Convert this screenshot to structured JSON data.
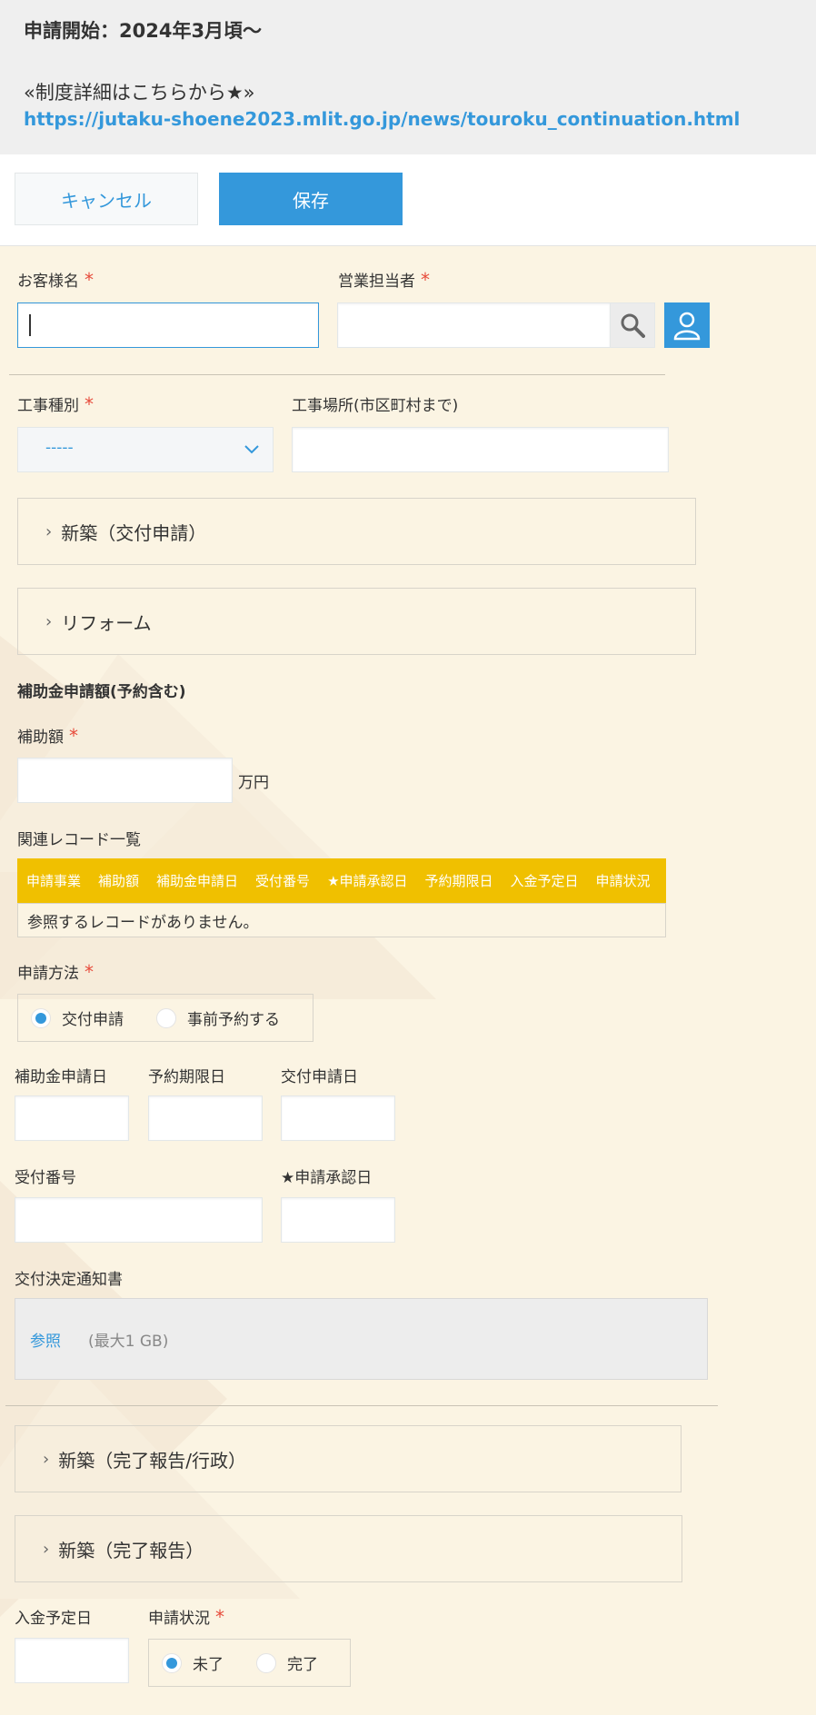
{
  "notice": {
    "start": "申請開始：2024年3月頃〜",
    "details": "«制度詳細はこちらから★»",
    "url": "https://jutaku-shoene2023.mlit.go.jp/news/touroku_continuation.html"
  },
  "toolbar": {
    "cancel_label": "キャンセル",
    "save_label": "保存"
  },
  "fields": {
    "customer_name": {
      "label": "お客様名",
      "required": "*",
      "value": ""
    },
    "sales_rep": {
      "label": "営業担当者",
      "required": "*",
      "value": ""
    },
    "work_type": {
      "label": "工事種別",
      "required": "*",
      "selected": "-----"
    },
    "work_location": {
      "label": "工事場所(市区町村まで)",
      "value": ""
    },
    "subsidy_amount": {
      "label": "補助額",
      "required": "*",
      "unit": "万円",
      "value": ""
    },
    "application_method": {
      "label": "申請方法",
      "required": "*",
      "options": [
        "交付申請",
        "事前予約する"
      ],
      "selected": "交付申請"
    },
    "subsidy_application_date": {
      "label": "補助金申請日",
      "value": ""
    },
    "reservation_deadline": {
      "label": "予約期限日",
      "value": ""
    },
    "grant_application_date": {
      "label": "交付申請日",
      "value": ""
    },
    "receipt_number": {
      "label": "受付番号",
      "value": ""
    },
    "approval_date": {
      "label": "★申請承認日",
      "value": ""
    },
    "grant_notice": {
      "label": "交付決定通知書",
      "browse": "参照",
      "max": "(最大1 GB)"
    },
    "payment_date": {
      "label": "入金予定日",
      "value": ""
    },
    "status": {
      "label": "申請状況",
      "required": "*",
      "options": [
        "未了",
        "完了"
      ],
      "selected": "未了"
    }
  },
  "groups": {
    "new_build_grant": "新築（交付申請）",
    "reform": "リフォーム",
    "new_build_completion_admin": "新築（完了報告/行政）",
    "new_build_completion": "新築（完了報告）"
  },
  "section_title": "補助金申請額(予約含む)",
  "related_records": {
    "label": "関連レコード一覧",
    "columns": [
      "申請事業",
      "補助額",
      "補助金申請日",
      "受付番号",
      "★申請承認日",
      "予約期限日",
      "入金予定日",
      "申請状況"
    ],
    "empty": "参照するレコードがありません。"
  },
  "icons": {
    "search": "search-icon",
    "user": "user-icon",
    "chevron": "chevron-right-icon",
    "dropdown": "chevron-down-icon"
  },
  "colors": {
    "accent": "#3498db",
    "required": "#e74c3c",
    "table_header": "#f0c000",
    "background": "#fbf4e3"
  }
}
